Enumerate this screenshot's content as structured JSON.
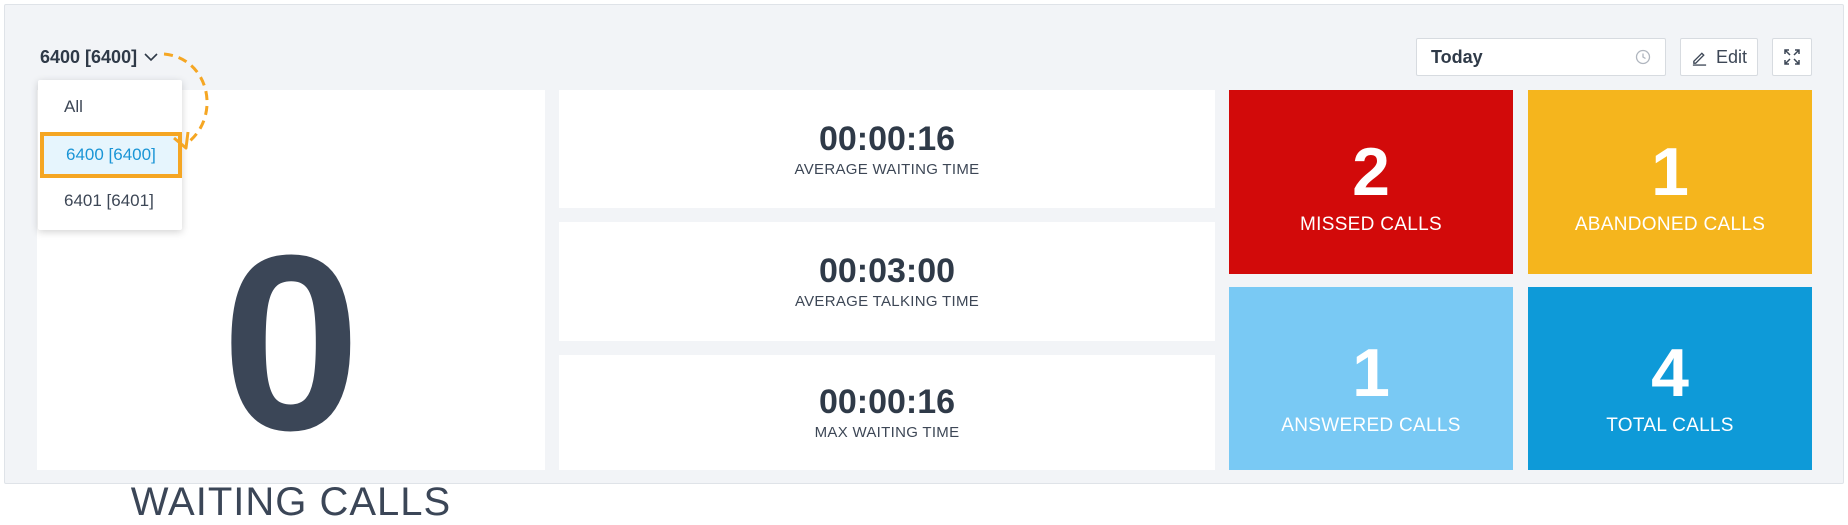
{
  "header": {
    "queue_selector": "6400 [6400]",
    "date_range": "Today",
    "edit_label": "Edit"
  },
  "dropdown": {
    "options": [
      "All",
      "6400 [6400]",
      "6401 [6401]"
    ],
    "selected_index": 1
  },
  "waiting": {
    "value": "0",
    "label": "WAITING CALLS"
  },
  "times": [
    {
      "value": "00:00:16",
      "label": "AVERAGE WAITING TIME"
    },
    {
      "value": "00:03:00",
      "label": "AVERAGE TALKING TIME"
    },
    {
      "value": "00:00:16",
      "label": "MAX WAITING TIME"
    }
  ],
  "stats": {
    "missed": {
      "value": "2",
      "label": "MISSED CALLS",
      "color": "#d20a0a"
    },
    "abandoned": {
      "value": "1",
      "label": "ABANDONED CALLS",
      "color": "#f5b51d"
    },
    "answered": {
      "value": "1",
      "label": "ANSWERED CALLS",
      "color": "#79c9f4"
    },
    "total": {
      "value": "4",
      "label": "TOTAL CALLS",
      "color": "#0e9ad8"
    }
  },
  "accent_color": "#f5a623"
}
